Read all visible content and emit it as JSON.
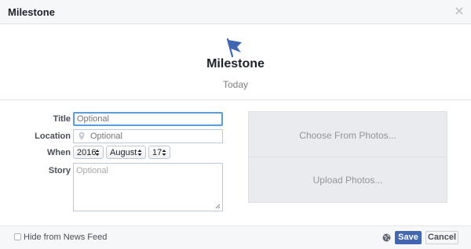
{
  "header": {
    "title": "Milestone",
    "close_icon": "close-x-icon"
  },
  "hero": {
    "icon": "flag-icon",
    "title": "Milestone",
    "subtitle": "Today",
    "accent": "#4267b2"
  },
  "form": {
    "title": {
      "label": "Title",
      "placeholder": "Optional",
      "value": ""
    },
    "location": {
      "label": "Location",
      "placeholder": "Optional",
      "value": "",
      "icon": "map-pin-icon"
    },
    "when": {
      "label": "When",
      "year": "2016",
      "month": "August",
      "day": "17"
    },
    "story": {
      "label": "Story",
      "placeholder": "Optional",
      "value": ""
    }
  },
  "photos": {
    "choose_label": "Choose From Photos...",
    "upload_label": "Upload Photos..."
  },
  "footer": {
    "hide_label": "Hide from News Feed",
    "hide_checked": false,
    "audience_icon": "globe-icon",
    "save_label": "Save",
    "cancel_label": "Cancel"
  }
}
